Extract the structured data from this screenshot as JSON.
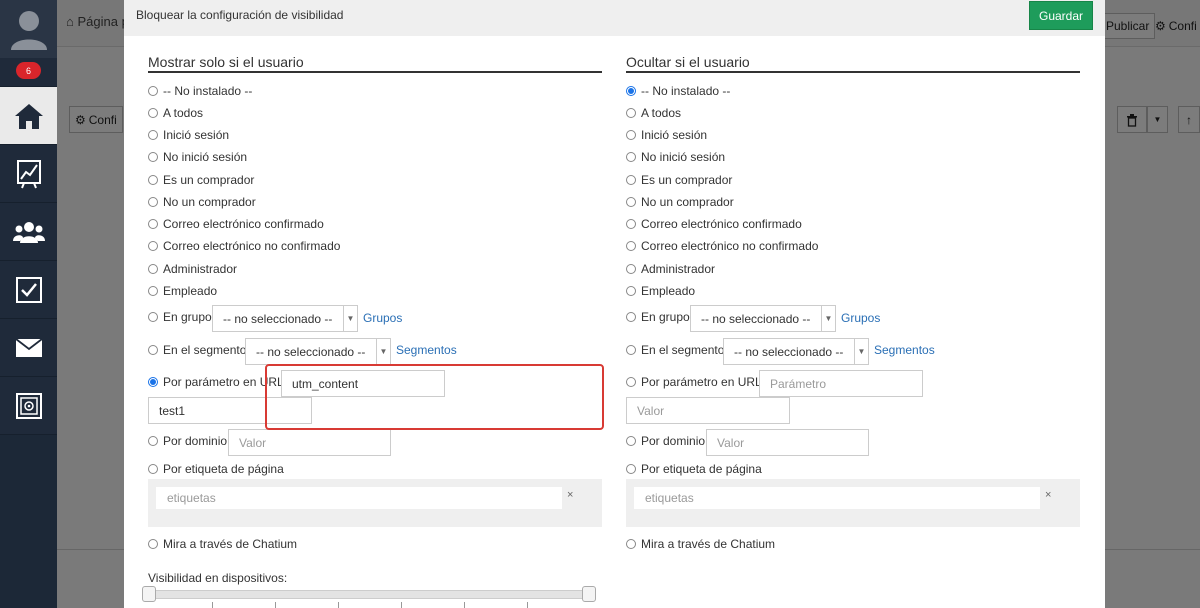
{
  "sidebar": {
    "badge": "6",
    "icons": [
      "user-avatar-icon",
      "home-icon",
      "chart-icon",
      "users-icon",
      "checkbox-icon",
      "mail-icon",
      "safe-icon"
    ]
  },
  "background": {
    "breadcrumb": "Página p",
    "publish": "Publicar",
    "config_top": "Confi",
    "config_left": "Confi"
  },
  "modal": {
    "title": "Bloquear la configuración de visibilidad",
    "save_label": "Guardar",
    "left_title": "Mostrar solo si el usuario",
    "right_title": "Ocultar si el usuario",
    "options": [
      "-- No instalado --",
      "A todos",
      "Inició sesión",
      "No inició sesión",
      "Es un comprador",
      "No un comprador",
      "Correo electrónico confirmado",
      "Correo electrónico no confirmado",
      "Administrador",
      "Empleado",
      "En grupo",
      "En el segmento",
      "Por parámetro en URL",
      "Por dominio",
      "Por etiqueta de página",
      "Mira a través de Chatium"
    ],
    "select_placeholder": "-- no seleccionado --",
    "groups_link": "Grupos",
    "segments_link": "Segmentos",
    "left": {
      "param_name": "utm_content",
      "param_value": "test1",
      "domain_placeholder": "Valor",
      "tags_placeholder": "etiquetas"
    },
    "right": {
      "param_placeholder": "Parámetro",
      "value_placeholder": "Valor",
      "domain_placeholder": "Valor",
      "tags_placeholder": "etiquetas"
    },
    "clear_symbol": "×",
    "devices_label": "Visibilidad en dispositivos:"
  }
}
